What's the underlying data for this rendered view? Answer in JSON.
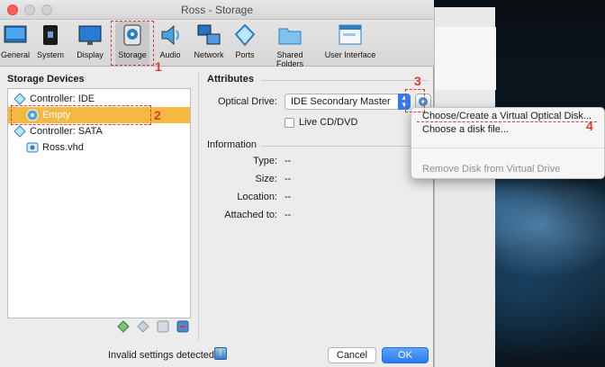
{
  "window": {
    "title": "Ross - Storage"
  },
  "toolbar": {
    "items": [
      {
        "label": "General",
        "icon": "general-icon"
      },
      {
        "label": "System",
        "icon": "system-icon"
      },
      {
        "label": "Display",
        "icon": "display-icon"
      },
      {
        "label": "Storage",
        "icon": "storage-icon",
        "selected": true
      },
      {
        "label": "Audio",
        "icon": "audio-icon"
      },
      {
        "label": "Network",
        "icon": "network-icon"
      },
      {
        "label": "Ports",
        "icon": "ports-icon"
      },
      {
        "label": "Shared Folders",
        "icon": "shared-folders-icon"
      },
      {
        "label": "User Interface",
        "icon": "user-interface-icon"
      }
    ]
  },
  "storage_devices": {
    "title": "Storage Devices",
    "tree": [
      {
        "label": "Controller: IDE",
        "icon": "ide-controller-icon"
      },
      {
        "label": "Empty",
        "icon": "optical-disk-icon",
        "selected": true
      },
      {
        "label": "Controller: SATA",
        "icon": "sata-controller-icon"
      },
      {
        "label": "Ross.vhd",
        "icon": "hard-disk-icon"
      }
    ]
  },
  "attributes": {
    "title": "Attributes",
    "optical_drive_label": "Optical Drive:",
    "optical_drive_value": "IDE Secondary Master",
    "live_cd_label": "Live CD/DVD"
  },
  "information": {
    "title": "Information",
    "rows": [
      {
        "label": "Type:",
        "value": "--"
      },
      {
        "label": "Size:",
        "value": "--"
      },
      {
        "label": "Location:",
        "value": "--"
      },
      {
        "label": "Attached to:",
        "value": "--"
      }
    ]
  },
  "context_menu": {
    "items": [
      {
        "label": "Choose/Create a Virtual Optical Disk...",
        "enabled": true
      },
      {
        "label": "Choose a disk file...",
        "enabled": true
      },
      {
        "label": "Remove Disk from Virtual Drive",
        "enabled": false
      }
    ]
  },
  "footer": {
    "warning": "Invalid settings detected",
    "cancel": "Cancel",
    "ok": "OK"
  },
  "annotations": [
    "1",
    "2",
    "3",
    "4"
  ],
  "colors": {
    "accent": "#2f7cf6",
    "highlight": "#f5b841",
    "annotation": "#e53935"
  }
}
